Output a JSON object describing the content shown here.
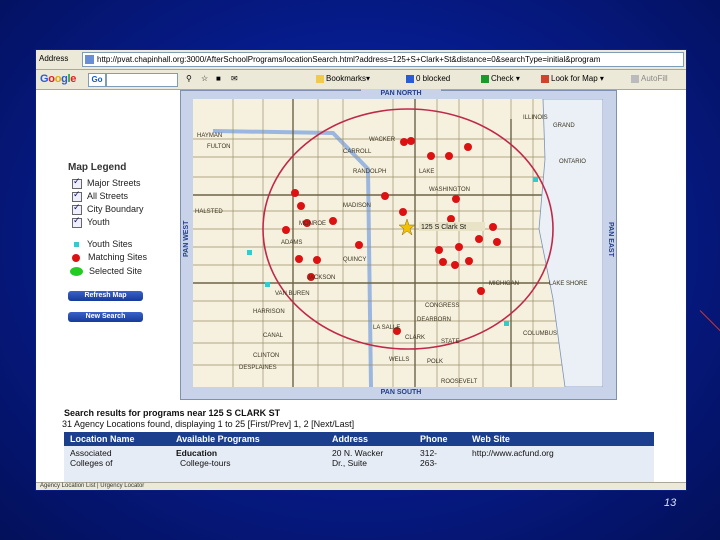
{
  "browser": {
    "address_label": "Address",
    "url": "http://pvat.chapinhall.org:3000/AfterSchoolPrograms/locationSearch.html?address=125+S+Clark+St&distance=0&searchType=initial&program",
    "google": {
      "logo": "Google",
      "go_label": "Go",
      "toolbar": [
        "Bookmarks▾",
        "0 blocked",
        "Check ▾",
        "Look for Map ▾",
        "AutoFill"
      ]
    },
    "status_text": "Agency Location List | Urgency Locator"
  },
  "legend": {
    "title": "Map Legend",
    "layers": [
      "Major Streets",
      "All Streets",
      "City Boundary",
      "Youth"
    ],
    "symbols": [
      {
        "label": "Youth Sites",
        "color": "#33cccc",
        "shape": "square"
      },
      {
        "label": "Matching Sites",
        "color": "#dd1111",
        "shape": "circle"
      },
      {
        "label": "Selected Site",
        "color": "#22cc22",
        "shape": "ellipse"
      }
    ],
    "refresh_button": "Refresh Map",
    "new_search_button": "New Search"
  },
  "map": {
    "pan_north": "PAN NORTH",
    "pan_south": "PAN SOUTH",
    "pan_west": "PAN WEST",
    "pan_east": "PAN EAST",
    "search_label": "125 S Clark St",
    "street_labels": [
      "HAYMAN",
      "FULTON",
      "CARROLL",
      "RANDOLPH",
      "LAKE",
      "WASHINGTON",
      "MADISON",
      "MONROE",
      "ADAMS",
      "QUINCY",
      "JACKSON",
      "VAN BUREN",
      "HARRISON",
      "POLK",
      "ROOSEVELT",
      "CONGRESS",
      "WACKER",
      "WELLS",
      "CLARK",
      "STATE",
      "LA SALLE",
      "DEARBORN",
      "CANAL",
      "CLINTON",
      "DESPLAINES",
      "HALSTED",
      "MICHIGAN",
      "COLUMBUS",
      "LAKE SHORE",
      "GRAND",
      "ILLINOIS",
      "ONTARIO"
    ]
  },
  "results": {
    "heading": "Search results for programs near 125 S CLARK ST",
    "summary": "31 Agency Locations found, displaying 1 to 25 [First/Prev] 1, 2 [Next/Last]",
    "columns": [
      "Location Name",
      "Available Programs",
      "Address",
      "Phone",
      "Web Site"
    ],
    "rows": [
      {
        "name": [
          "Associated",
          "Colleges of"
        ],
        "programs": [
          "Education",
          "College-tours"
        ],
        "address": [
          "20 N. Wacker",
          "Dr., Suite"
        ],
        "phone": [
          "312-",
          "263-"
        ],
        "web": "http://www.acfund.org"
      }
    ]
  },
  "slide_number": "13",
  "colors": {
    "slide_bg": "#061a86",
    "matching_site": "#dd1111",
    "youth_site": "#33cccc",
    "selected_site": "#22cc22",
    "header_blue": "#1b3f8c",
    "circle": "#c0284a"
  }
}
